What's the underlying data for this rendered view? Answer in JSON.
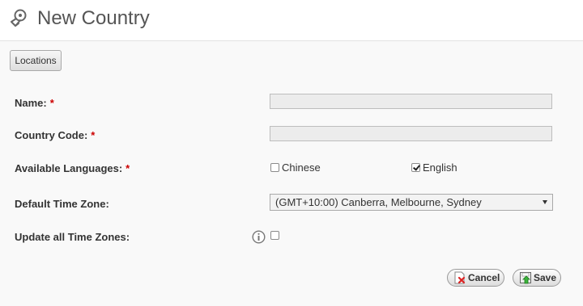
{
  "header": {
    "title": "New Country",
    "icon": "map-pin-compass-icon"
  },
  "toolbar": {
    "locations_label": "Locations"
  },
  "form": {
    "name": {
      "label": "Name:",
      "required_mark": "*",
      "value": ""
    },
    "country_code": {
      "label": "Country Code:",
      "required_mark": "*",
      "value": ""
    },
    "available_languages": {
      "label": "Available Languages:",
      "required_mark": "*",
      "options": [
        {
          "label": "Chinese",
          "checked": false
        },
        {
          "label": "English",
          "checked": true
        }
      ]
    },
    "default_time_zone": {
      "label": "Default Time Zone:",
      "selected": "(GMT+10:00) Canberra, Melbourne, Sydney"
    },
    "update_all_time_zones": {
      "label": "Update all Time Zones:",
      "checked": false,
      "info_icon": "info-icon"
    }
  },
  "actions": {
    "cancel_label": "Cancel",
    "save_label": "Save"
  },
  "colors": {
    "required": "#cc0000",
    "header_bg": "#ffffff",
    "page_bg": "#f9f9f9"
  }
}
